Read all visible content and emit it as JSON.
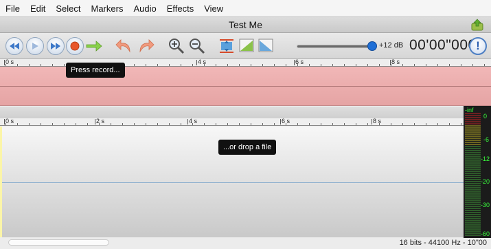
{
  "menu": [
    "File",
    "Edit",
    "Select",
    "Markers",
    "Audio",
    "Effects",
    "View"
  ],
  "window": {
    "title": "Test Me"
  },
  "toolbar": {
    "gain_label": "+12 dB",
    "gain_level_fraction": 1.0,
    "time": "00'00\"000",
    "help_glyph": "!"
  },
  "icons": {
    "rewind": "rewind-icon",
    "play": "play-icon",
    "fast_forward": "fast-forward-icon",
    "record": "record-icon",
    "forward_arrow": "arrow-right-icon",
    "undo": "undo-icon",
    "redo": "redo-icon",
    "zoom_in": "zoom-in-icon",
    "zoom_out": "zoom-out-icon",
    "fit": "fit-icon",
    "ramp_up": "ramp-up-icon",
    "ramp_down": "ramp-down-icon",
    "export": "export-icon"
  },
  "ruler_top": [
    "0 s",
    "4 s",
    "6 s",
    "8 s"
  ],
  "ruler_bottom": [
    "0 s",
    "2 s",
    "4 s",
    "6 s",
    "8 s"
  ],
  "tooltips": {
    "record": "Press record...",
    "drop": "...or drop a file"
  },
  "meter": {
    "labels": [
      "-inf",
      "0",
      "-6",
      "-12",
      "-20",
      "-30",
      "-60"
    ]
  },
  "status": "16 bits - 44100 Hz - 10\"00",
  "colors": {
    "accent": "#1f6fd6",
    "record": "#e8572a",
    "track_pink": "#eeb0b0",
    "meter_green": "#39ff3c"
  }
}
